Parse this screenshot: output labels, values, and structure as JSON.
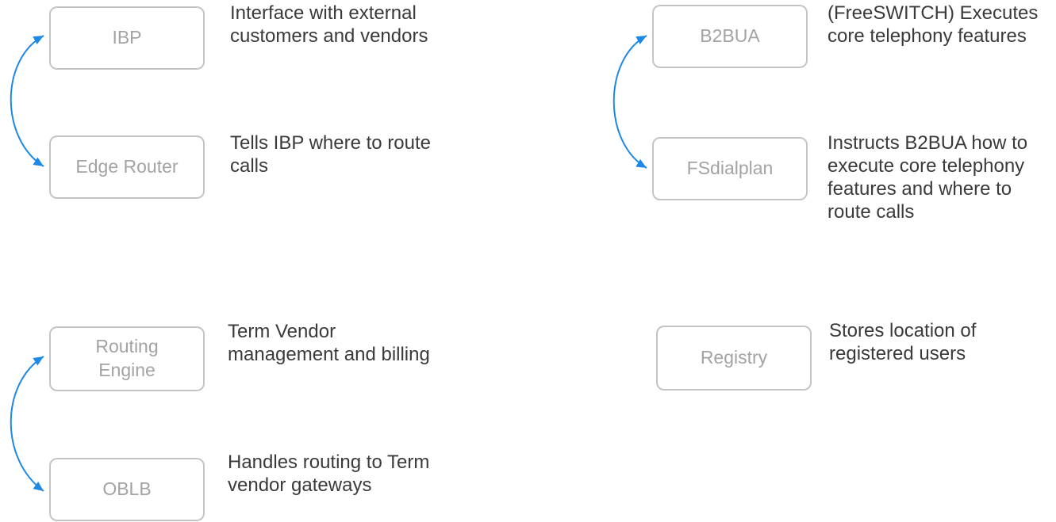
{
  "colors": {
    "box_border": "#c4c4c4",
    "box_text": "#a3a3a3",
    "description_text": "#3a3a3a",
    "connector": "#1e88e5"
  },
  "nodes": {
    "ibp": {
      "label": "IBP",
      "description": "Interface with external\ncustomers and vendors"
    },
    "edge_router": {
      "label": "Edge Router",
      "description": "Tells IBP where to route\ncalls"
    },
    "b2bua": {
      "label": "B2BUA",
      "description": "(FreeSWITCH) Executes\ncore telephony features"
    },
    "fsdialplan": {
      "label": "FSdialplan",
      "description": "Instructs B2BUA how to\nexecute core telephony\nfeatures and where to\nroute calls"
    },
    "routing_engine": {
      "label": "Routing\nEngine",
      "description": "Term Vendor\nmanagement and billing"
    },
    "oblb": {
      "label": "OBLB",
      "description": "Handles routing to Term\nvendor gateways"
    },
    "registry": {
      "label": "Registry",
      "description": "Stores location of\nregistered users"
    }
  }
}
